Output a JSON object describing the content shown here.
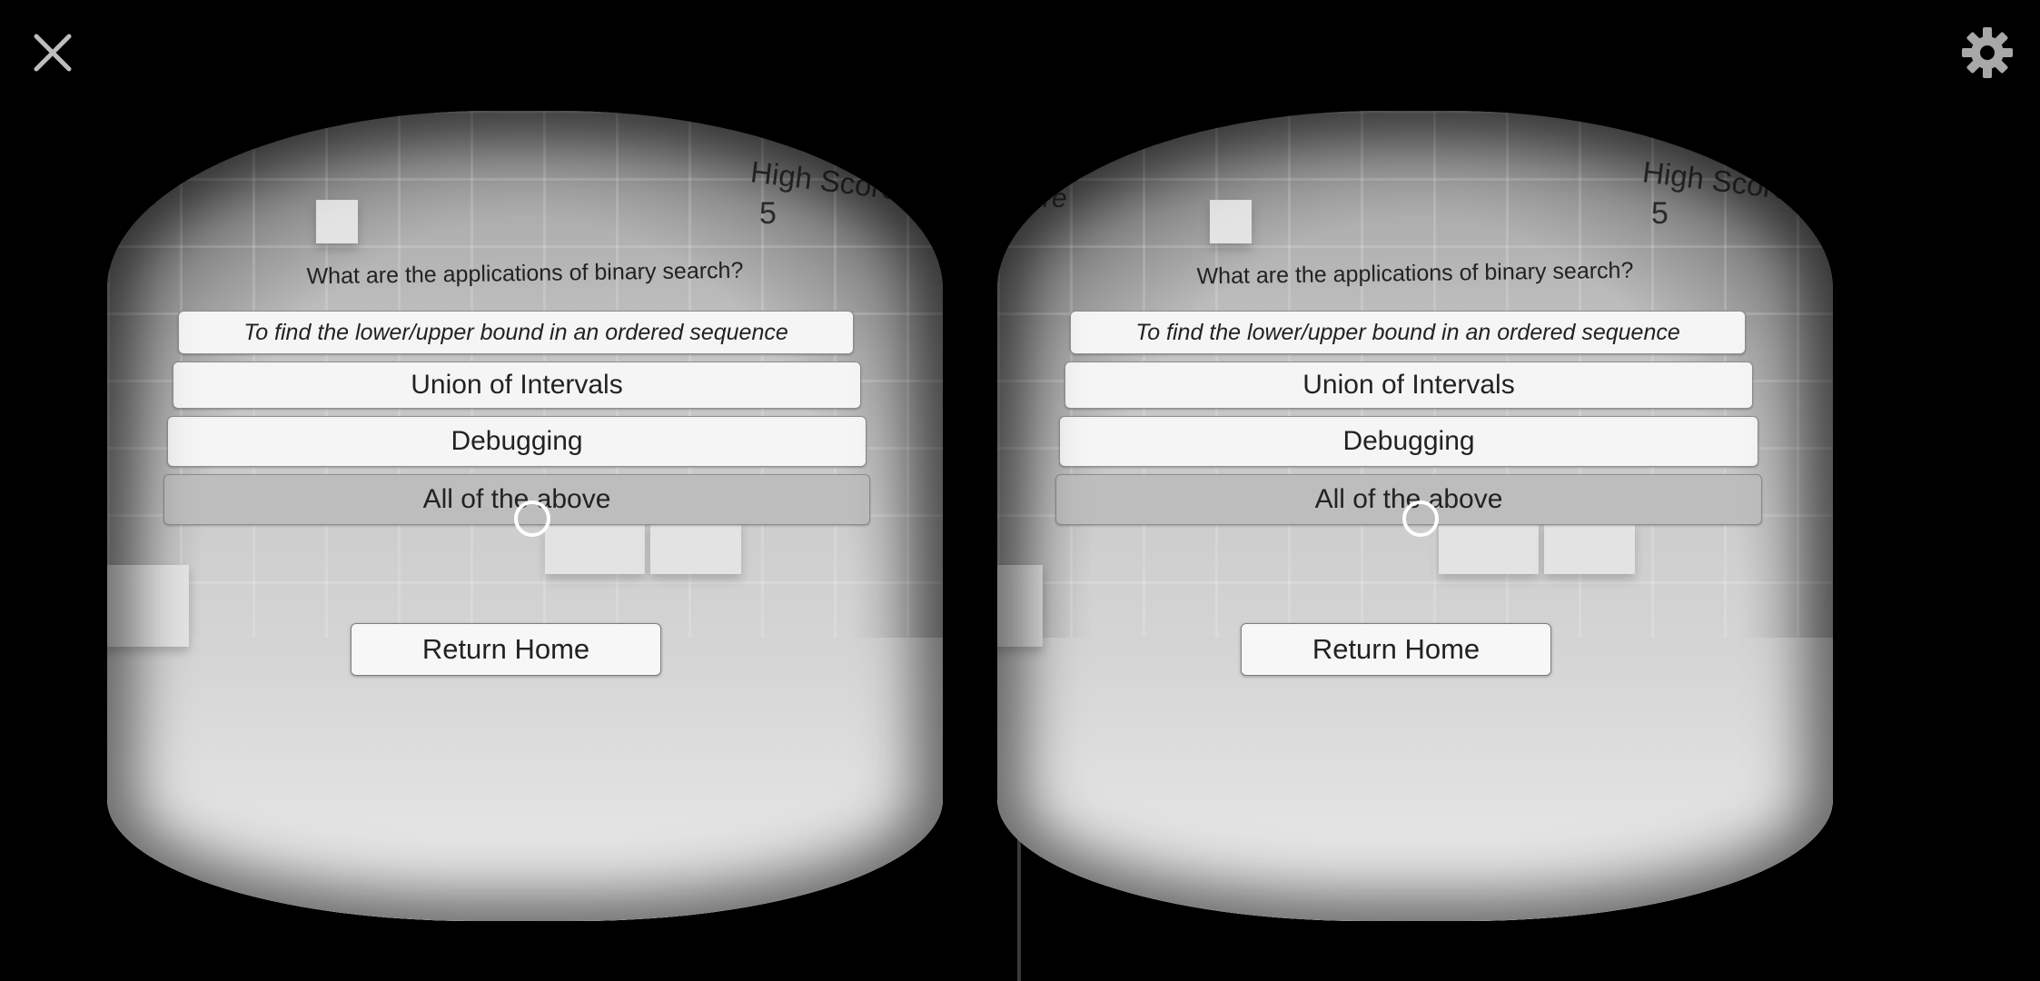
{
  "toolbar": {
    "close_icon": "close-icon",
    "settings_icon": "gear-icon"
  },
  "hud": {
    "score_label_partial": "re",
    "high_score_label": "High Score",
    "high_score_value": "5"
  },
  "question": {
    "text": "What are the applications of binary search?"
  },
  "answers": [
    {
      "label": "To find the lower/upper bound in an ordered sequence",
      "selected": false
    },
    {
      "label": "Union of Intervals",
      "selected": false
    },
    {
      "label": "Debugging",
      "selected": false
    },
    {
      "label": "All of the above",
      "selected": true
    }
  ],
  "return_home_label": "Return Home"
}
